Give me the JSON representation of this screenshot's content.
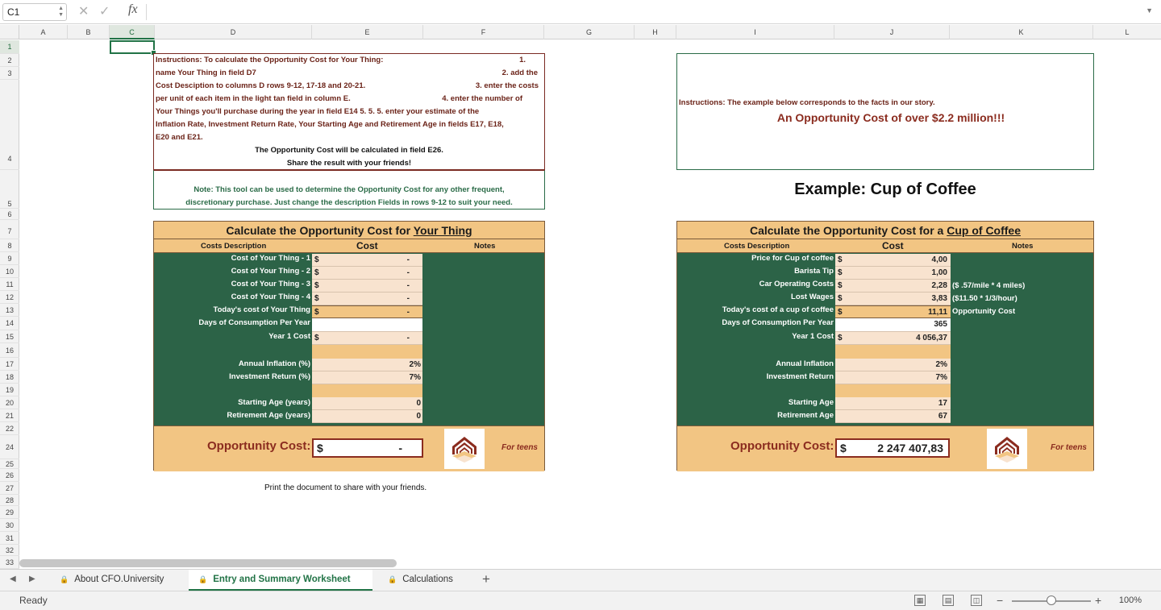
{
  "formula_bar": {
    "name_box": "C1",
    "fx_label": "fx",
    "formula": ""
  },
  "columns": [
    "A",
    "B",
    "C",
    "D",
    "E",
    "F",
    "G",
    "H",
    "I",
    "J",
    "K",
    "L"
  ],
  "rows": [
    "1",
    "2",
    "3",
    "4",
    "5",
    "6",
    "7",
    "8",
    "9",
    "10",
    "11",
    "12",
    "13",
    "14",
    "15",
    "16",
    "17",
    "18",
    "19",
    "20",
    "21",
    "22",
    "24",
    "25",
    "26",
    "27",
    "28",
    "29",
    "30",
    "31",
    "32",
    "33"
  ],
  "left_instructions": {
    "lines": [
      "Instructions:  To calculate the Opportunity Cost for Your Thing:",
      "name Your Thing in field D7",
      "Cost Desciption to columns D rows 9-12, 17-18 and 20-21.",
      "per unit of each item in the light tan field in column E.",
      "Your Things you'll purchase during the year in field E14  5. 5.  5. enter your estimate of  the",
      "Inflation Rate, Investment Return Rate, Your Starting Age and Retirement Age in fields E17, E18,",
      "E20 and E21."
    ],
    "right_steps": [
      "1.",
      "2. add the",
      "3. enter the costs",
      "4. enter the number of"
    ],
    "center_lines": [
      "The Opportunity Cost will be calculated in field E26.",
      "Share the result with your friends!"
    ],
    "note_lines": [
      "Note: This tool can be used to determine the Opportunity Cost for any other frequent,",
      "discretionary purchase.   Just change the description Fields in rows 9-12 to suit your need."
    ]
  },
  "right_instructions": {
    "line": "Instructions:  The example below corresponds to the facts in our story.",
    "headline": "An Opportunity Cost of over $2.2 million!!!"
  },
  "example_title": "Example:  Cup of Coffee",
  "your_table": {
    "title_prefix": "Calculate the Opportunity Cost for ",
    "title_underlined": "Your Thing",
    "col_desc": "Costs Description",
    "col_cost": "Cost",
    "col_notes": "Notes",
    "rows": [
      {
        "label": "Cost of Your Thing - 1",
        "cur": "$",
        "value": "-"
      },
      {
        "label": "Cost of Your Thing - 2",
        "cur": "$",
        "value": "-"
      },
      {
        "label": "Cost of Your Thing - 3",
        "cur": "$",
        "value": "-"
      },
      {
        "label": "Cost of Your Thing - 4",
        "cur": "$",
        "value": "-"
      },
      {
        "label": "Today's cost of Your Thing",
        "cur": "$",
        "value": "-"
      },
      {
        "label": "Days of Consumption Per Year",
        "cur": "",
        "value": ""
      },
      {
        "label": "Year 1 Cost",
        "cur": "$",
        "value": "-"
      }
    ],
    "rates": [
      {
        "label": "Annual Inflation (%)",
        "value": "2%"
      },
      {
        "label": "Investment Return (%)",
        "value": "7%"
      }
    ],
    "ages": [
      {
        "label": "Starting Age (years)",
        "value": "0"
      },
      {
        "label": "Retirement Age (years)",
        "value": "0"
      }
    ],
    "opp_label": "Opportunity Cost:",
    "opp_cur": "$",
    "opp_value": "-",
    "teens": "For teens"
  },
  "example_table": {
    "title_prefix": "Calculate the Opportunity Cost for  a ",
    "title_underlined": "Cup of Coffee ",
    "col_desc": "Costs Description",
    "col_cost": "Cost",
    "col_notes": "Notes",
    "rows": [
      {
        "label": "Price for Cup of coffee",
        "cur": "$",
        "value": "4,00",
        "note": ""
      },
      {
        "label": "Barista Tip",
        "cur": "$",
        "value": "1,00",
        "note": ""
      },
      {
        "label": "Car Operating Costs",
        "cur": "$",
        "value": "2,28",
        "note": "($ .57/mile * 4 miles)"
      },
      {
        "label": "Lost Wages",
        "cur": "$",
        "value": "3,83",
        "note": "($11.50 * 1/3/hour)"
      },
      {
        "label": "Today's cost of a cup of coffee",
        "cur": "$",
        "value": "11,11",
        "note": "Opportunity Cost"
      },
      {
        "label": "Days of Consumption Per Year",
        "cur": "",
        "value": "365",
        "note": ""
      },
      {
        "label": "Year 1 Cost",
        "cur": "$",
        "value": "4 056,37",
        "note": ""
      }
    ],
    "rates": [
      {
        "label": "Annual Inflation",
        "value": "2%"
      },
      {
        "label": "Investment Return",
        "value": "7%"
      }
    ],
    "ages": [
      {
        "label": "Starting Age",
        "value": "17"
      },
      {
        "label": "Retirement Age",
        "value": "67"
      }
    ],
    "opp_label": "Opportunity Cost:",
    "opp_cur": "$",
    "opp_value": "2 247 407,83",
    "teens": "For teens"
  },
  "print_note": "Print the document to share with your friends.",
  "sheet_tabs": [
    {
      "label": "About CFO.University",
      "active": false
    },
    {
      "label": "Entry and Summary Worksheet",
      "active": true
    },
    {
      "label": "Calculations",
      "active": false
    }
  ],
  "add_sheet": "+",
  "status": "Ready",
  "zoom": "100%",
  "colors": {
    "accent": "#217346",
    "table_green": "#2c6347",
    "tan": "#f2c583",
    "maroon": "#8b2c1f"
  }
}
